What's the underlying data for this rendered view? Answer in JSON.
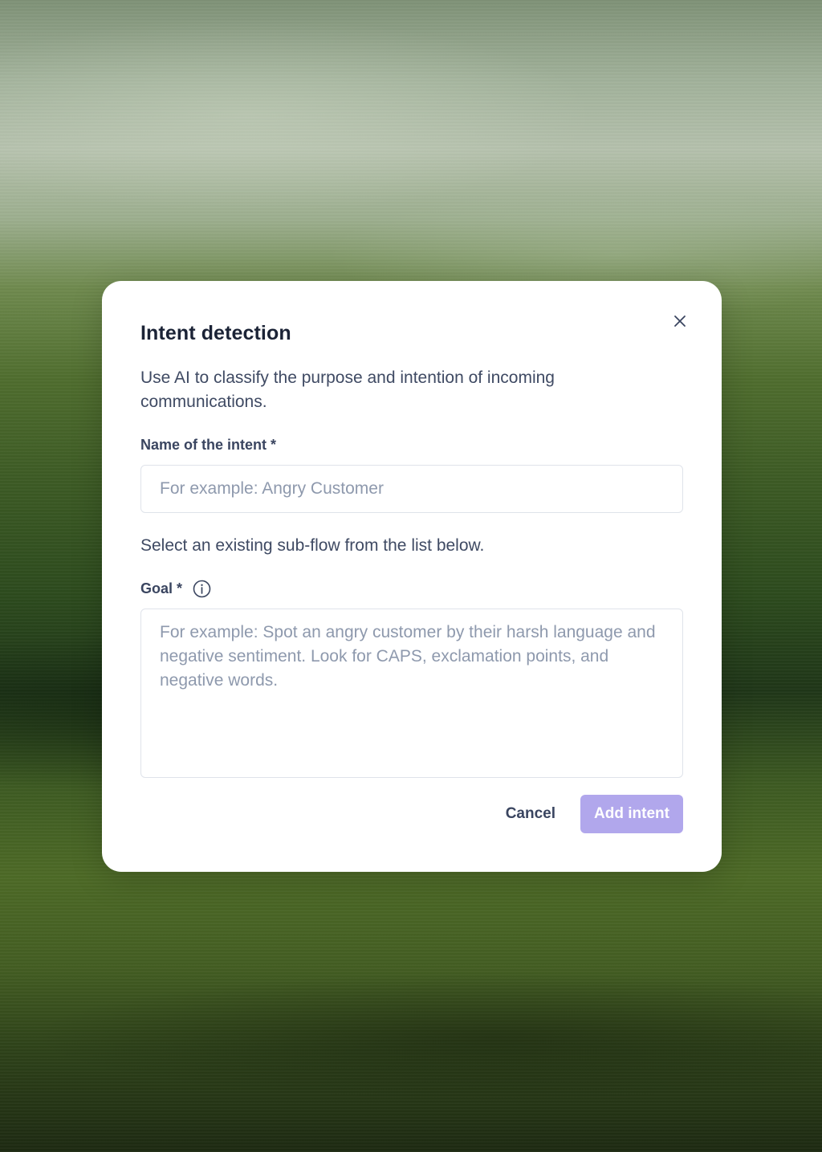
{
  "dialog": {
    "title": "Intent detection",
    "description": "Use AI to classify the purpose and intention of incoming communications.",
    "close_icon": "close-icon",
    "name_field": {
      "label": "Name of the intent *",
      "placeholder": "For example: Angry Customer",
      "value": ""
    },
    "helper_text": "Select an existing sub-flow from the list below.",
    "goal_field": {
      "label": "Goal *",
      "info_icon": "info-icon",
      "placeholder": "For example: Spot an angry customer by their harsh language and negative sentiment. Look for CAPS, exclamation points, and negative words.",
      "value": ""
    },
    "actions": {
      "cancel_label": "Cancel",
      "submit_label": "Add intent"
    }
  },
  "colors": {
    "primary_button": "#b1a7ec",
    "title_text": "#1b2336",
    "body_text": "#3f4a63",
    "placeholder_text": "#8e99ad",
    "input_border": "#dfe3ea"
  }
}
